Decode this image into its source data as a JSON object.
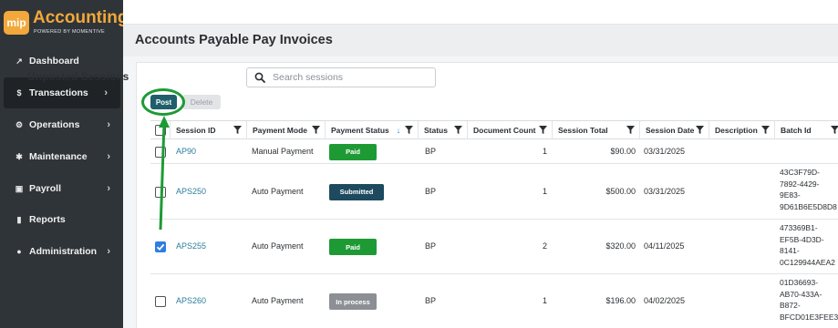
{
  "app": {
    "logo_badge": "mip",
    "logo_title": "Accounting",
    "logo_subtitle": "POWERED BY MOMENTIVE",
    "brand_color": "#f2a83b"
  },
  "sidebar": {
    "items": [
      {
        "label": "Dashboard",
        "icon": "chart-line-icon",
        "has_chevron": false,
        "active": false
      },
      {
        "label": "Transactions",
        "icon": "dollar-icon",
        "has_chevron": true,
        "active": true
      },
      {
        "label": "Operations",
        "icon": "gears-icon",
        "has_chevron": true,
        "active": false
      },
      {
        "label": "Maintenance",
        "icon": "wrench-icon",
        "has_chevron": true,
        "active": false
      },
      {
        "label": "Payroll",
        "icon": "money-bill-icon",
        "has_chevron": true,
        "active": false
      },
      {
        "label": "Reports",
        "icon": "file-icon",
        "has_chevron": false,
        "active": false
      },
      {
        "label": "Administration",
        "icon": "users-icon",
        "has_chevron": true,
        "active": false
      }
    ]
  },
  "page": {
    "title": "Accounts Payable Pay Invoices",
    "sessions_label": "Unposted Sessions",
    "search_placeholder": "Search sessions",
    "post_label": "Post",
    "delete_label": "Delete"
  },
  "table": {
    "columns": [
      "Session ID",
      "Payment Mode",
      "Payment Status",
      "Status",
      "Document Count",
      "Session Total",
      "Session Date",
      "Description",
      "Batch Id"
    ],
    "sorted_column": "Payment Status",
    "rows": [
      {
        "checked": false,
        "session_id": "AP90",
        "payment_mode": "Manual Payment",
        "payment_status": "Paid",
        "status": "BP",
        "document_count": "1",
        "session_total": "$90.00",
        "session_date": "03/31/2025",
        "description": "",
        "batch_id": ""
      },
      {
        "checked": false,
        "session_id": "APS250",
        "payment_mode": "Auto Payment",
        "payment_status": "Submitted",
        "status": "BP",
        "document_count": "1",
        "session_total": "$500.00",
        "session_date": "03/31/2025",
        "description": "",
        "batch_id": "43C3F79D-\n7892-4429-\n9E83-\n9D61B6E5D8D8"
      },
      {
        "checked": true,
        "session_id": "APS255",
        "payment_mode": "Auto Payment",
        "payment_status": "Paid",
        "status": "BP",
        "document_count": "2",
        "session_total": "$320.00",
        "session_date": "04/11/2025",
        "description": "",
        "batch_id": "473369B1-\nEF5B-4D3D-\n8141-\n0C129944AEA2"
      },
      {
        "checked": false,
        "session_id": "APS260",
        "payment_mode": "Auto Payment",
        "payment_status": "In process",
        "status": "BP",
        "document_count": "1",
        "session_total": "$196.00",
        "session_date": "04/02/2025",
        "description": "",
        "batch_id": "01D36693-\nAB70-433A-\nB872-\nBFCD01E3FEE3"
      }
    ]
  },
  "status_colors": {
    "Paid": "#1e9a35",
    "Submitted": "#1d4a5e",
    "In process": "#8c9095"
  },
  "annotation": {
    "highlight_color": "#1e9a35"
  }
}
